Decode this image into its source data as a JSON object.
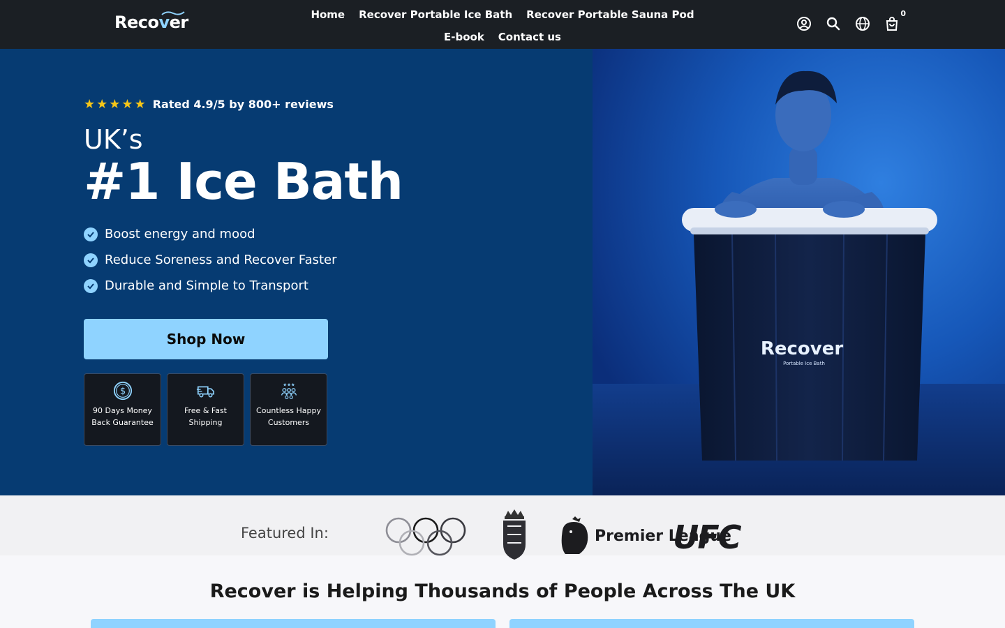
{
  "header": {
    "logo": {
      "text_main": "Reco",
      "text_accent": "v",
      "text_end": "er"
    },
    "nav_row1": [
      "Home",
      "Recover Portable Ice Bath",
      "Recover Portable Sauna Pod"
    ],
    "nav_row2": [
      "E-book",
      "Contact us"
    ],
    "icons": [
      "account-icon",
      "search-icon",
      "globe-icon",
      "cart-icon"
    ],
    "cart_count": "0"
  },
  "hero": {
    "rating_text": "Rated 4.9/5 by 800+ reviews",
    "star_count": 5,
    "title_small": "UK’s",
    "title_big": "#1 Ice Bath",
    "benefits": [
      "Boost energy and mood",
      "Reduce Soreness and Recover Faster",
      "Durable and Simple to Transport"
    ],
    "cta_label": "Shop Now",
    "features": [
      {
        "icon": "money-back-icon",
        "label": "90 Days Money Back Guarantee"
      },
      {
        "icon": "delivery-truck-icon",
        "label": "Free & Fast Shipping"
      },
      {
        "icon": "happy-customers-icon",
        "label": "Countless Happy Customers"
      }
    ],
    "product_brand": "Recover",
    "product_sub": "Portable Ice Bath"
  },
  "featured": {
    "label": "Featured In:",
    "partners": [
      "Premier League",
      "UFC"
    ],
    "partner_icons": [
      "olympic-rings-logo",
      "england-cricket-logo",
      "premier-league-logo",
      "ufc-logo"
    ]
  },
  "section": {
    "title": "Recover is Helping Thousands of People Across The UK"
  },
  "colors": {
    "header_bg": "#1b1f24",
    "hero_bg": "#063b72",
    "accent": "#8fd3ff",
    "star": "#f5c518"
  }
}
